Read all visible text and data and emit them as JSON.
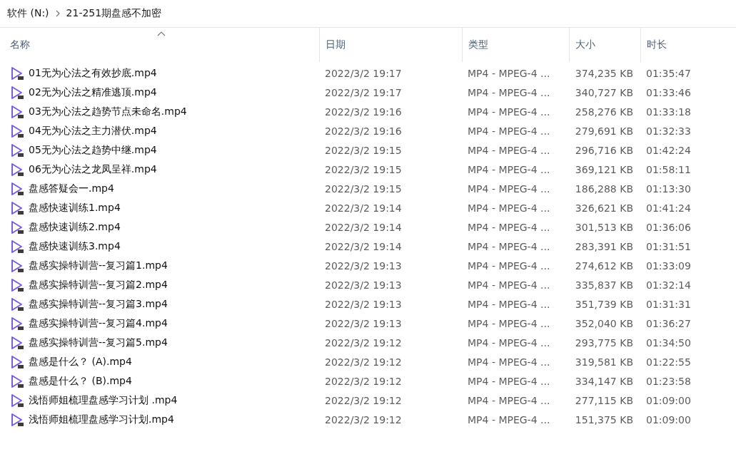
{
  "breadcrumb": [
    "软件 (N:)",
    "21-251期盘感不加密"
  ],
  "columns": [
    {
      "label": "名称",
      "sorted": true
    },
    {
      "label": "日期",
      "sorted": false
    },
    {
      "label": "类型",
      "sorted": false
    },
    {
      "label": "大小",
      "sorted": false
    },
    {
      "label": "时长",
      "sorted": false
    }
  ],
  "rows": [
    {
      "name": "01无为心法之有效抄底.mp4",
      "date": "2022/3/2 19:17",
      "type": "MP4 - MPEG-4 ...",
      "size": "374,235 KB",
      "length": "01:35:47"
    },
    {
      "name": "02无为心法之精准逃顶.mp4",
      "date": "2022/3/2 19:17",
      "type": "MP4 - MPEG-4 ...",
      "size": "340,727 KB",
      "length": "01:33:46"
    },
    {
      "name": "03无为心法之趋势节点未命名.mp4",
      "date": "2022/3/2 19:16",
      "type": "MP4 - MPEG-4 ...",
      "size": "258,276 KB",
      "length": "01:33:18"
    },
    {
      "name": "04无为心法之主力潜伏.mp4",
      "date": "2022/3/2 19:16",
      "type": "MP4 - MPEG-4 ...",
      "size": "279,691 KB",
      "length": "01:32:33"
    },
    {
      "name": "05无为心法之趋势中继.mp4",
      "date": "2022/3/2 19:15",
      "type": "MP4 - MPEG-4 ...",
      "size": "296,716 KB",
      "length": "01:42:24"
    },
    {
      "name": "06无为心法之龙凤呈祥.mp4",
      "date": "2022/3/2 19:15",
      "type": "MP4 - MPEG-4 ...",
      "size": "369,121 KB",
      "length": "01:58:11"
    },
    {
      "name": "盘感答疑会一.mp4",
      "date": "2022/3/2 19:15",
      "type": "MP4 - MPEG-4 ...",
      "size": "186,288 KB",
      "length": "01:13:30"
    },
    {
      "name": "盘感快速训练1.mp4",
      "date": "2022/3/2 19:14",
      "type": "MP4 - MPEG-4 ...",
      "size": "326,621 KB",
      "length": "01:41:24"
    },
    {
      "name": "盘感快速训练2.mp4",
      "date": "2022/3/2 19:14",
      "type": "MP4 - MPEG-4 ...",
      "size": "301,513 KB",
      "length": "01:36:06"
    },
    {
      "name": "盘感快速训练3.mp4",
      "date": "2022/3/2 19:14",
      "type": "MP4 - MPEG-4 ...",
      "size": "283,391 KB",
      "length": "01:31:51"
    },
    {
      "name": "盘感实操特训营--复习篇1.mp4",
      "date": "2022/3/2 19:13",
      "type": "MP4 - MPEG-4 ...",
      "size": "274,612 KB",
      "length": "01:33:09"
    },
    {
      "name": "盘感实操特训营--复习篇2.mp4",
      "date": "2022/3/2 19:13",
      "type": "MP4 - MPEG-4 ...",
      "size": "335,837 KB",
      "length": "01:32:14"
    },
    {
      "name": "盘感实操特训营--复习篇3.mp4",
      "date": "2022/3/2 19:13",
      "type": "MP4 - MPEG-4 ...",
      "size": "351,739 KB",
      "length": "01:31:31"
    },
    {
      "name": "盘感实操特训营--复习篇4.mp4",
      "date": "2022/3/2 19:13",
      "type": "MP4 - MPEG-4 ...",
      "size": "352,040 KB",
      "length": "01:36:27"
    },
    {
      "name": "盘感实操特训营--复习篇5.mp4",
      "date": "2022/3/2 19:12",
      "type": "MP4 - MPEG-4 ...",
      "size": "293,775 KB",
      "length": "01:34:50"
    },
    {
      "name": "盘感是什么？ (A).mp4",
      "date": "2022/3/2 19:12",
      "type": "MP4 - MPEG-4 ...",
      "size": "319,581 KB",
      "length": "01:22:55"
    },
    {
      "name": "盘感是什么？ (B).mp4",
      "date": "2022/3/2 19:12",
      "type": "MP4 - MPEG-4 ...",
      "size": "334,147 KB",
      "length": "01:23:58"
    },
    {
      "name": "浅悟师姐梳理盘感学习计划 .mp4",
      "date": "2022/3/2 19:12",
      "type": "MP4 - MPEG-4 ...",
      "size": "277,115 KB",
      "length": "01:09:00"
    },
    {
      "name": "浅悟师姐梳理盘感学习计划.mp4",
      "date": "2022/3/2 19:12",
      "type": "MP4 - MPEG-4 ...",
      "size": "151,375 KB",
      "length": "01:09:00"
    }
  ]
}
